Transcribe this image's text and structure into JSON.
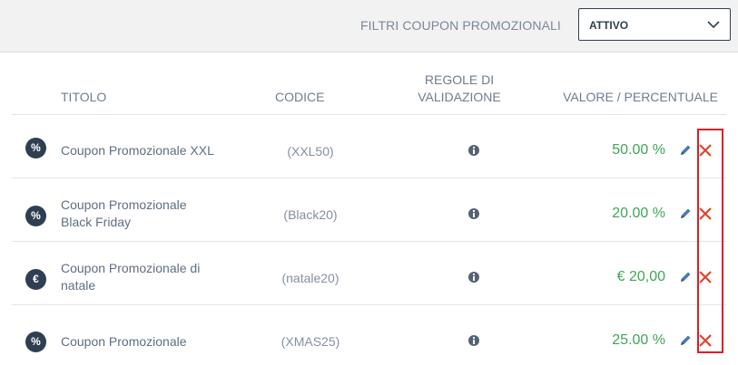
{
  "filter": {
    "label": "FILTRI COUPON PROMOZIONALI",
    "selected": "ATTIVO",
    "chevron_icon": "chevron-down-icon"
  },
  "table": {
    "headers": {
      "titolo": "TITOLO",
      "codice": "CODICE",
      "regole": "REGOLE DI VALIDAZIONE",
      "valore": "VALORE / PERCENTUALE"
    },
    "rows": [
      {
        "type_symbol": "%",
        "title": "Coupon Promozionale XXL",
        "code": "(XXL50)",
        "value": "50.00 %"
      },
      {
        "type_symbol": "%",
        "title": "Coupon Promozionale Black Friday",
        "code": "(Black20)",
        "value": "20.00 %"
      },
      {
        "type_symbol": "€",
        "title": "Coupon Promozionale di natale",
        "code": "(natale20)",
        "value": "€ 20,00"
      },
      {
        "type_symbol": "%",
        "title": "Coupon Promozionale",
        "code": "(XMAS25)",
        "value": "25.00 %"
      }
    ]
  },
  "colors": {
    "value_green": "#3fa556",
    "delete_red": "#e0442b",
    "edit_blue": "#4a78b5",
    "highlight_red": "#d9202a",
    "badge_dark": "#2f3f52"
  }
}
